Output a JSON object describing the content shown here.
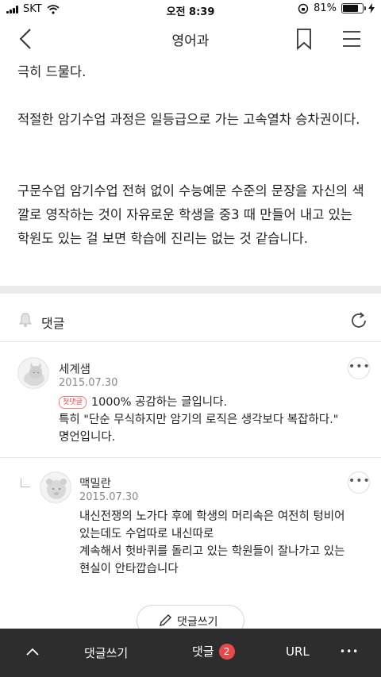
{
  "status_bar": {
    "carrier": "SKT",
    "time": "오전 8:39",
    "battery": "81%",
    "battery_level": 0.81
  },
  "nav": {
    "title": "영어과",
    "icons": [
      "chevron-left-icon",
      "bookmark-icon",
      "hamburger-menu-icon"
    ]
  },
  "article": {
    "paragraphs": [
      "극히 드물다.",
      "적절한 암기수업 과정은 일등급으로 가는 고속열차 승차권이다.",
      "구문수업 암기수업 전혀 없이 수능예문 수준의 문장을 자신의 색깔로 영작하는 것이 자유로운 학생을 중3 때 만들어 내고 있는 학원도 있는 걸 보면 학습에 진리는 없는 것 같습니다."
    ]
  },
  "comments_section": {
    "title": "댓글",
    "comments": [
      {
        "author": "세계샘",
        "date": "2015.07.30",
        "badge": "첫댓글",
        "lines": [
          "1000% 공감하는 글입니다.",
          "특히 \"단순 무식하지만 암기의 로직은 생각보다 복잡하다.\"",
          "명언입니다."
        ]
      },
      {
        "author": "맥밀란",
        "date": "2015.07.30",
        "lines": [
          "내신전쟁의 노가다 후에 학생의 머리속은 여전히 텅비어",
          "있는데도 수업따로 내신따로",
          "계속해서 헛바퀴를 돌리고 있는 학원들이 잘나가고 있는",
          "현실이 안타깝습니다"
        ]
      }
    ],
    "write_button": "댓글쓰기"
  },
  "bottom_bar": {
    "write": "댓글쓰기",
    "comments": "댓글",
    "comment_count": "2",
    "url": "URL",
    "more": "•••"
  },
  "colors": {
    "accent_red": "#e84a4a",
    "bottom_bar_bg": "#2d2d2d",
    "separator": "#ececec"
  }
}
